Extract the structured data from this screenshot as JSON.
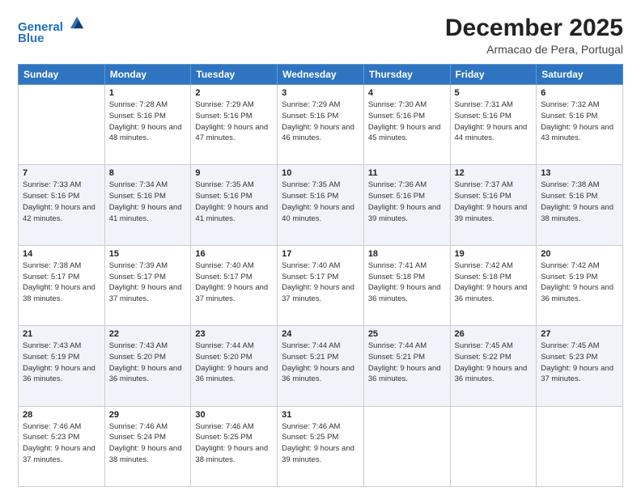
{
  "logo": {
    "line1": "General",
    "line2": "Blue"
  },
  "header": {
    "month": "December 2025",
    "location": "Armacao de Pera, Portugal"
  },
  "days": [
    "Sunday",
    "Monday",
    "Tuesday",
    "Wednesday",
    "Thursday",
    "Friday",
    "Saturday"
  ],
  "weeks": [
    [
      {
        "date": "",
        "sunrise": "",
        "sunset": "",
        "daylight": ""
      },
      {
        "date": "1",
        "sunrise": "Sunrise: 7:28 AM",
        "sunset": "Sunset: 5:16 PM",
        "daylight": "Daylight: 9 hours and 48 minutes."
      },
      {
        "date": "2",
        "sunrise": "Sunrise: 7:29 AM",
        "sunset": "Sunset: 5:16 PM",
        "daylight": "Daylight: 9 hours and 47 minutes."
      },
      {
        "date": "3",
        "sunrise": "Sunrise: 7:29 AM",
        "sunset": "Sunset: 5:16 PM",
        "daylight": "Daylight: 9 hours and 46 minutes."
      },
      {
        "date": "4",
        "sunrise": "Sunrise: 7:30 AM",
        "sunset": "Sunset: 5:16 PM",
        "daylight": "Daylight: 9 hours and 45 minutes."
      },
      {
        "date": "5",
        "sunrise": "Sunrise: 7:31 AM",
        "sunset": "Sunset: 5:16 PM",
        "daylight": "Daylight: 9 hours and 44 minutes."
      },
      {
        "date": "6",
        "sunrise": "Sunrise: 7:32 AM",
        "sunset": "Sunset: 5:16 PM",
        "daylight": "Daylight: 9 hours and 43 minutes."
      }
    ],
    [
      {
        "date": "7",
        "sunrise": "Sunrise: 7:33 AM",
        "sunset": "Sunset: 5:16 PM",
        "daylight": "Daylight: 9 hours and 42 minutes."
      },
      {
        "date": "8",
        "sunrise": "Sunrise: 7:34 AM",
        "sunset": "Sunset: 5:16 PM",
        "daylight": "Daylight: 9 hours and 41 minutes."
      },
      {
        "date": "9",
        "sunrise": "Sunrise: 7:35 AM",
        "sunset": "Sunset: 5:16 PM",
        "daylight": "Daylight: 9 hours and 41 minutes."
      },
      {
        "date": "10",
        "sunrise": "Sunrise: 7:35 AM",
        "sunset": "Sunset: 5:16 PM",
        "daylight": "Daylight: 9 hours and 40 minutes."
      },
      {
        "date": "11",
        "sunrise": "Sunrise: 7:36 AM",
        "sunset": "Sunset: 5:16 PM",
        "daylight": "Daylight: 9 hours and 39 minutes."
      },
      {
        "date": "12",
        "sunrise": "Sunrise: 7:37 AM",
        "sunset": "Sunset: 5:16 PM",
        "daylight": "Daylight: 9 hours and 39 minutes."
      },
      {
        "date": "13",
        "sunrise": "Sunrise: 7:38 AM",
        "sunset": "Sunset: 5:16 PM",
        "daylight": "Daylight: 9 hours and 38 minutes."
      }
    ],
    [
      {
        "date": "14",
        "sunrise": "Sunrise: 7:38 AM",
        "sunset": "Sunset: 5:17 PM",
        "daylight": "Daylight: 9 hours and 38 minutes."
      },
      {
        "date": "15",
        "sunrise": "Sunrise: 7:39 AM",
        "sunset": "Sunset: 5:17 PM",
        "daylight": "Daylight: 9 hours and 37 minutes."
      },
      {
        "date": "16",
        "sunrise": "Sunrise: 7:40 AM",
        "sunset": "Sunset: 5:17 PM",
        "daylight": "Daylight: 9 hours and 37 minutes."
      },
      {
        "date": "17",
        "sunrise": "Sunrise: 7:40 AM",
        "sunset": "Sunset: 5:17 PM",
        "daylight": "Daylight: 9 hours and 37 minutes."
      },
      {
        "date": "18",
        "sunrise": "Sunrise: 7:41 AM",
        "sunset": "Sunset: 5:18 PM",
        "daylight": "Daylight: 9 hours and 36 minutes."
      },
      {
        "date": "19",
        "sunrise": "Sunrise: 7:42 AM",
        "sunset": "Sunset: 5:18 PM",
        "daylight": "Daylight: 9 hours and 36 minutes."
      },
      {
        "date": "20",
        "sunrise": "Sunrise: 7:42 AM",
        "sunset": "Sunset: 5:19 PM",
        "daylight": "Daylight: 9 hours and 36 minutes."
      }
    ],
    [
      {
        "date": "21",
        "sunrise": "Sunrise: 7:43 AM",
        "sunset": "Sunset: 5:19 PM",
        "daylight": "Daylight: 9 hours and 36 minutes."
      },
      {
        "date": "22",
        "sunrise": "Sunrise: 7:43 AM",
        "sunset": "Sunset: 5:20 PM",
        "daylight": "Daylight: 9 hours and 36 minutes."
      },
      {
        "date": "23",
        "sunrise": "Sunrise: 7:44 AM",
        "sunset": "Sunset: 5:20 PM",
        "daylight": "Daylight: 9 hours and 36 minutes."
      },
      {
        "date": "24",
        "sunrise": "Sunrise: 7:44 AM",
        "sunset": "Sunset: 5:21 PM",
        "daylight": "Daylight: 9 hours and 36 minutes."
      },
      {
        "date": "25",
        "sunrise": "Sunrise: 7:44 AM",
        "sunset": "Sunset: 5:21 PM",
        "daylight": "Daylight: 9 hours and 36 minutes."
      },
      {
        "date": "26",
        "sunrise": "Sunrise: 7:45 AM",
        "sunset": "Sunset: 5:22 PM",
        "daylight": "Daylight: 9 hours and 36 minutes."
      },
      {
        "date": "27",
        "sunrise": "Sunrise: 7:45 AM",
        "sunset": "Sunset: 5:23 PM",
        "daylight": "Daylight: 9 hours and 37 minutes."
      }
    ],
    [
      {
        "date": "28",
        "sunrise": "Sunrise: 7:46 AM",
        "sunset": "Sunset: 5:23 PM",
        "daylight": "Daylight: 9 hours and 37 minutes."
      },
      {
        "date": "29",
        "sunrise": "Sunrise: 7:46 AM",
        "sunset": "Sunset: 5:24 PM",
        "daylight": "Daylight: 9 hours and 38 minutes."
      },
      {
        "date": "30",
        "sunrise": "Sunrise: 7:46 AM",
        "sunset": "Sunset: 5:25 PM",
        "daylight": "Daylight: 9 hours and 38 minutes."
      },
      {
        "date": "31",
        "sunrise": "Sunrise: 7:46 AM",
        "sunset": "Sunset: 5:25 PM",
        "daylight": "Daylight: 9 hours and 39 minutes."
      },
      {
        "date": "",
        "sunrise": "",
        "sunset": "",
        "daylight": ""
      },
      {
        "date": "",
        "sunrise": "",
        "sunset": "",
        "daylight": ""
      },
      {
        "date": "",
        "sunrise": "",
        "sunset": "",
        "daylight": ""
      }
    ]
  ]
}
